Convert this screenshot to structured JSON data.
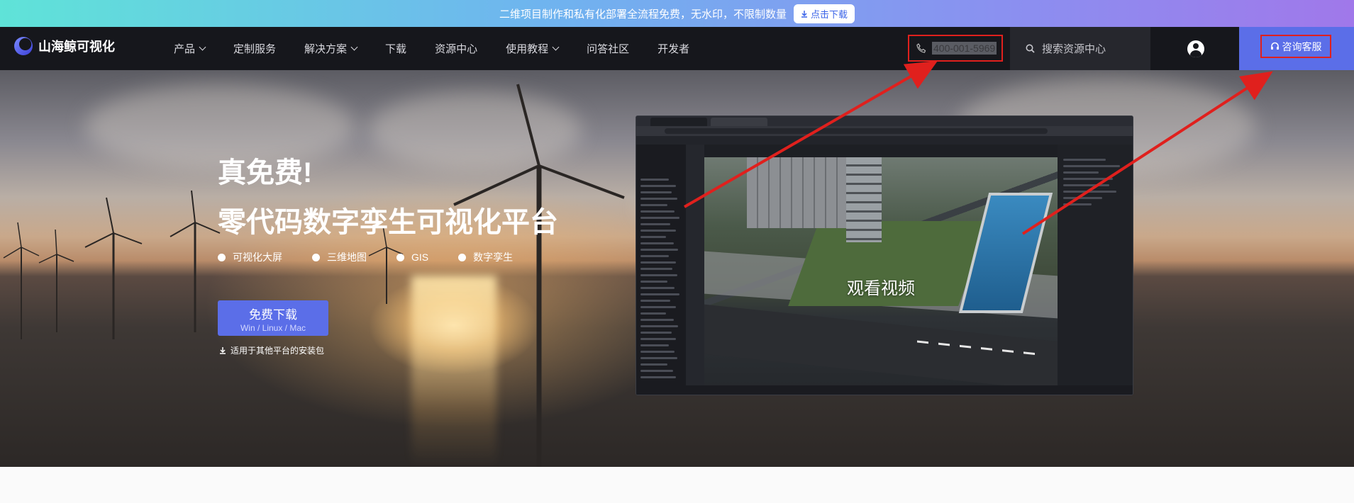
{
  "promo": {
    "text": "二维项目制作和私有化部署全流程免费，无水印，不限制数量",
    "button": "点击下载"
  },
  "nav": {
    "logo": "山海鲸可视化",
    "items": [
      {
        "label": "产品",
        "dropdown": true
      },
      {
        "label": "定制服务",
        "dropdown": false
      },
      {
        "label": "解决方案",
        "dropdown": true
      },
      {
        "label": "下载",
        "dropdown": false
      },
      {
        "label": "资源中心",
        "dropdown": false
      },
      {
        "label": "使用教程",
        "dropdown": true
      },
      {
        "label": "问答社区",
        "dropdown": false
      },
      {
        "label": "开发者",
        "dropdown": false
      }
    ],
    "phone": "400-001-5969",
    "search_placeholder": "搜索资源中心",
    "service": "咨询客服"
  },
  "hero": {
    "title": "真免费!",
    "subtitle": "零代码数字孪生可视化平台",
    "features": [
      "可视化大屏",
      "三维地图",
      "GIS",
      "数字孪生"
    ],
    "download_main": "免费下载",
    "download_sub": "Win / Linux / Mac",
    "other_platforms": "适用于其他平台的安装包",
    "video_label": "观看视频"
  },
  "colors": {
    "accent": "#5b6ee8",
    "nav_bg": "#16171c",
    "highlight": "#e0201d"
  }
}
